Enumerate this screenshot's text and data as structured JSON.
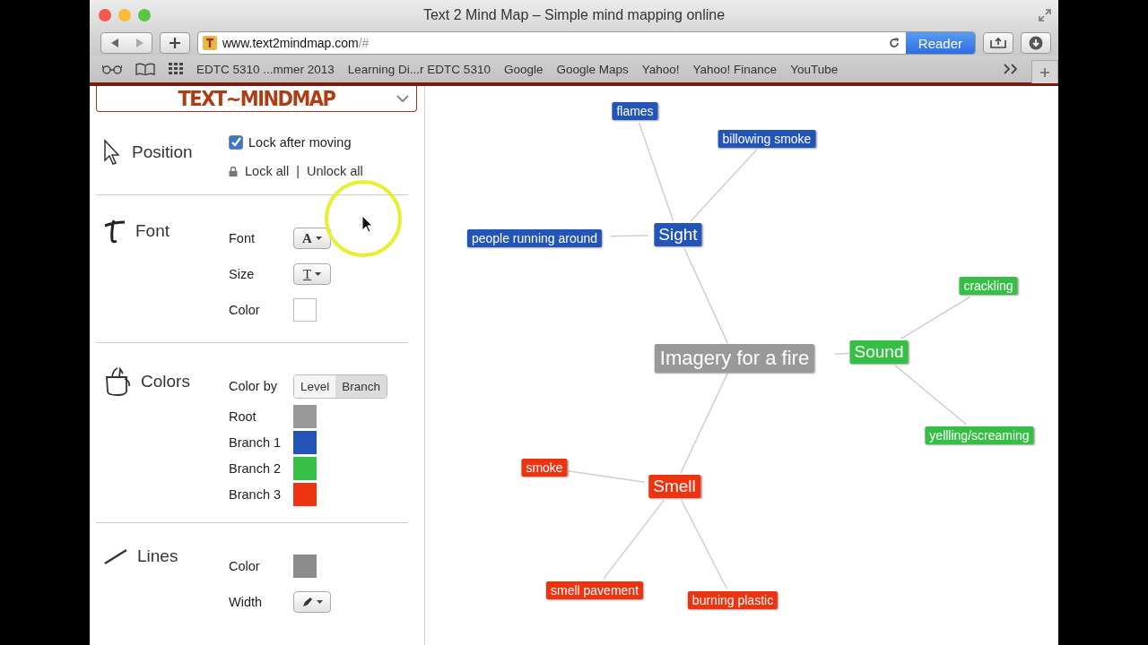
{
  "window": {
    "title": "Text 2 Mind Map – Simple mind mapping online"
  },
  "toolbar": {
    "url": "www.text2mindmap.com",
    "url_suffix": "/#",
    "reader": "Reader"
  },
  "bookmarks": [
    "EDTC 5310 ...mmer 2013",
    "Learning Di...r EDTC 5310",
    "Google",
    "Google Maps",
    "Yahoo!",
    "Yahoo! Finance",
    "YouTube"
  ],
  "logo": "TEXT~MINDMAP",
  "position": {
    "title": "Position",
    "lock_after_moving": {
      "label": "Lock after moving",
      "checked": true
    },
    "lock_all": "Lock all",
    "separator": "|",
    "unlock_all": "Unlock all"
  },
  "font": {
    "title": "Font",
    "rows": [
      {
        "label": "Font",
        "kind": "font",
        "glyph": "A"
      },
      {
        "label": "Size",
        "kind": "size",
        "glyph": "T"
      },
      {
        "label": "Color",
        "kind": "swatch",
        "color": "#ffffff"
      }
    ]
  },
  "colors": {
    "title": "Colors",
    "color_by": {
      "label": "Color by",
      "options": [
        {
          "label": "Level",
          "selected": false
        },
        {
          "label": "Branch",
          "selected": true
        }
      ]
    },
    "legend": [
      {
        "label": "Root",
        "color": "#999999"
      },
      {
        "label": "Branch 1",
        "color": "#2354b8"
      },
      {
        "label": "Branch 2",
        "color": "#35c045"
      },
      {
        "label": "Branch 3",
        "color": "#ee3311"
      }
    ]
  },
  "lines": {
    "title": "Lines",
    "rows": [
      {
        "label": "Color",
        "kind": "swatch",
        "color": "#8c8c8c"
      },
      {
        "label": "Width",
        "kind": "width"
      }
    ]
  },
  "map": {
    "root": {
      "text": "Imagery for a fire",
      "color": "#999999"
    },
    "branches": [
      {
        "text": "Sight",
        "color": "#2354b8",
        "children": [
          {
            "text": "flames"
          },
          {
            "text": "billowing smoke"
          },
          {
            "text": "people running around"
          }
        ]
      },
      {
        "text": "Sound",
        "color": "#35c045",
        "children": [
          {
            "text": "crackling"
          },
          {
            "text": "yellling/screaming"
          }
        ]
      },
      {
        "text": "Smell",
        "color": "#ee3311",
        "children": [
          {
            "text": "smoke"
          },
          {
            "text": "smell pavement"
          },
          {
            "text": "burning plastic"
          }
        ]
      }
    ]
  }
}
